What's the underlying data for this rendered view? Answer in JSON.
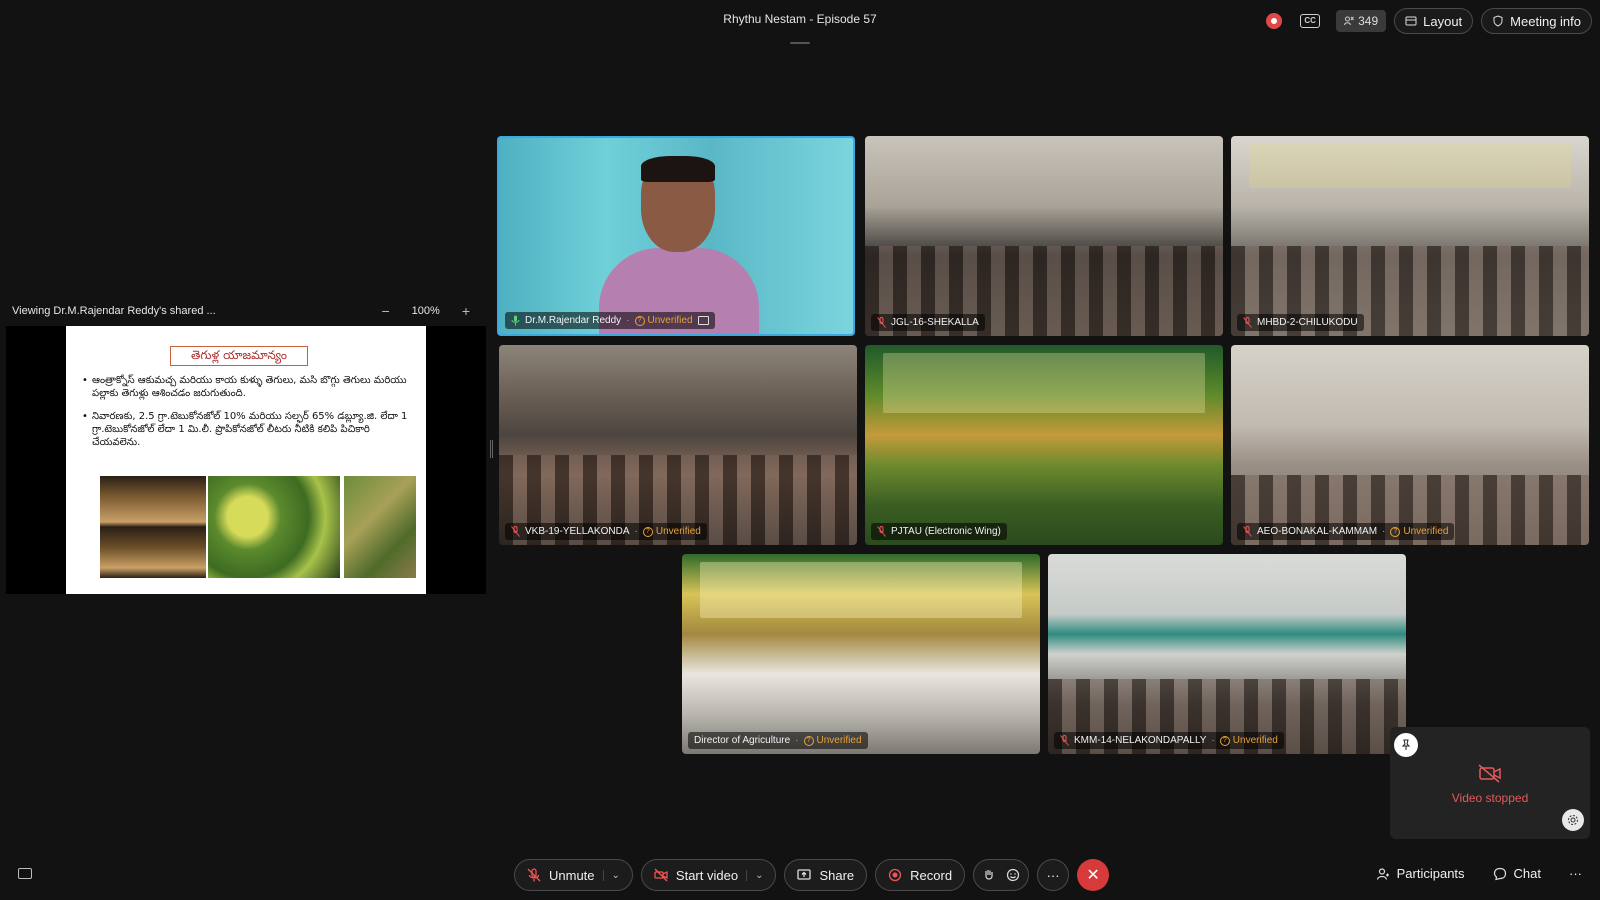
{
  "meeting": {
    "title": "Rhythu Nestam - Episode 57",
    "participant_count": "349",
    "layout_label": "Layout",
    "meeting_info_label": "Meeting info"
  },
  "share": {
    "header_label": "Viewing Dr.M.Rajendar Reddy's shared ...",
    "zoom_minus": "−",
    "zoom_level": "100%",
    "zoom_plus": "+",
    "slide": {
      "title": "తెగుళ్ల యాజమాన్యం",
      "bullets": [
        "ఆంత్రాక్నోస్ ఆకుమచ్చ మరియు కాయ కుళ్ళు తెగులు, మసి బొగ్గు తెగులు మరియు పల్లాకు తెగుళ్లు ఆశించడం జరుగుతుంది.",
        "నివారణకు, 2.5 గ్రా.టెబుకోనజోల్ 10% మరియు సల్ఫర్ 65% డబ్ల్యూ.జి. లేదా 1 గ్రా.టెబుకోనజోల్ లేదా 1 మి.లీ. ప్రొపికోనజోల్ లీటరు నీటికి కలిపి పిచికారి చేయవలెను."
      ]
    }
  },
  "tiles": [
    {
      "name": "Dr.M.Rajendar Reddy",
      "status": "Unverified",
      "active": true
    },
    {
      "name": "JGL-16-SHEKALLA",
      "status": ""
    },
    {
      "name": "MHBD-2-CHILUKODU",
      "status": ""
    },
    {
      "name": "VKB-19-YELLAKONDA",
      "status": "Unverified"
    },
    {
      "name": "PJTAU (Electronic Wing)",
      "status": ""
    },
    {
      "name": "AEO-BONAKAL-KAMMAM",
      "status": "Unverified"
    },
    {
      "name": "Director of Agriculture",
      "status": "Unverified"
    },
    {
      "name": "KMM-14-NELAKONDAPALLY",
      "status": "Unverified"
    }
  ],
  "self_view": {
    "status_text": "Video stopped"
  },
  "toolbar": {
    "unmute_label": "Unmute",
    "start_video_label": "Start video",
    "share_label": "Share",
    "record_label": "Record",
    "more_label": "···",
    "participants_label": "Participants",
    "chat_label": "Chat",
    "overflow_label": "···"
  },
  "colors": {
    "accent": "#3da7e0",
    "unverified": "#e8a23b",
    "end_call": "#d63a3a",
    "video_stopped_text": "#e35a5a"
  },
  "icons": [
    "record-indicator-icon",
    "closed-caption-icon",
    "participants-count-icon",
    "layout-icon",
    "shield-icon",
    "mic-muted-icon",
    "video-off-icon",
    "share-icon",
    "record-icon",
    "raise-hand-icon",
    "reaction-icon",
    "end-call-icon",
    "participants-icon",
    "chat-icon",
    "pin-icon",
    "settings-icon"
  ]
}
